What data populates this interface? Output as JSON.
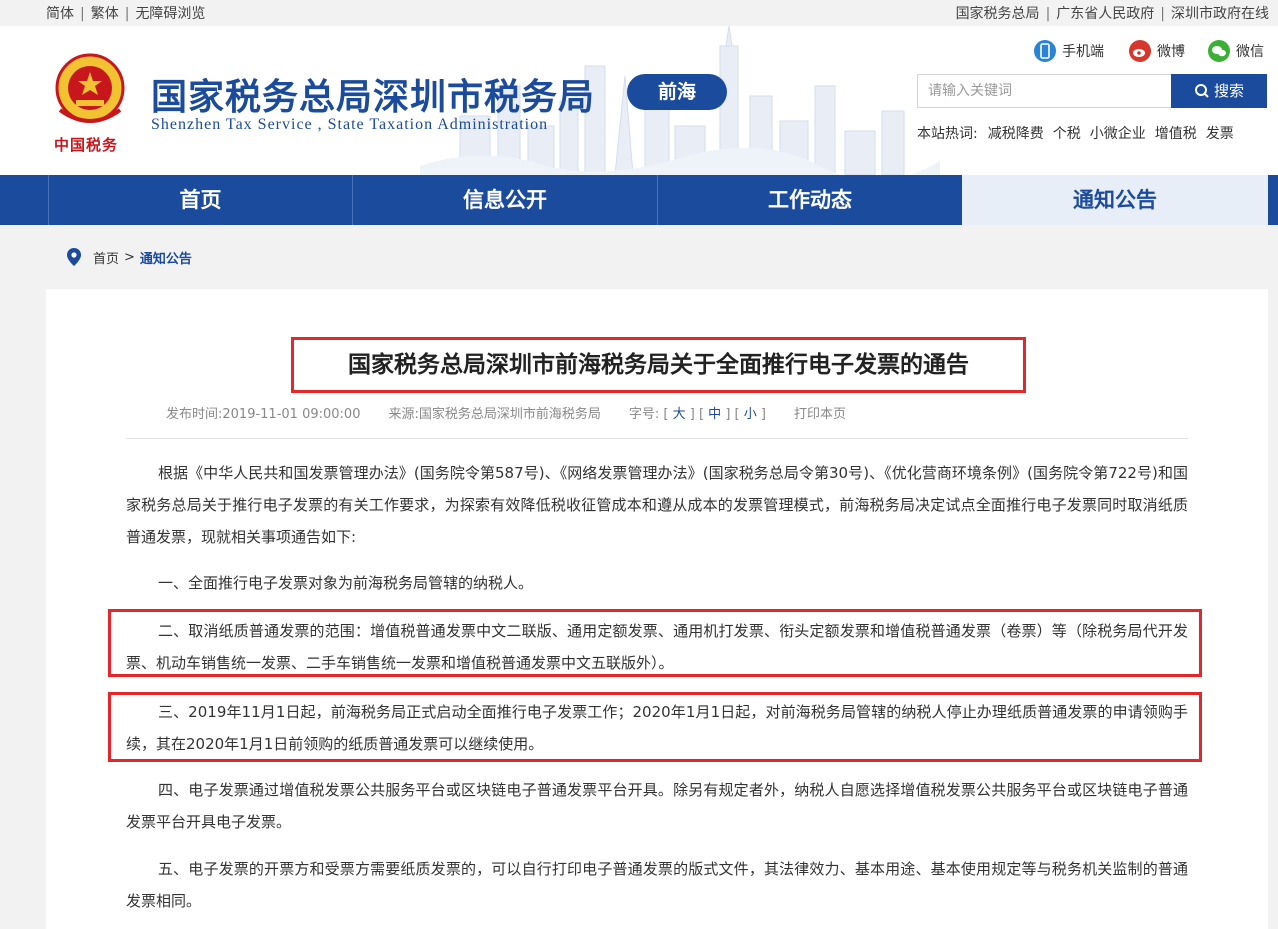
{
  "topbar": {
    "left_links": [
      "简体",
      "繁体",
      "无障碍浏览"
    ],
    "right_links": [
      "国家税务总局",
      "广东省人民政府",
      "深圳市政府在线"
    ]
  },
  "header": {
    "emblem_text": "中国税务",
    "title": "国家税务总局深圳市税务局",
    "subtitle": "Shenzhen  Tax  Service , State  Taxation  Administration",
    "region_badge": "前海",
    "social": {
      "mobile": "手机端",
      "weibo": "微博",
      "wechat": "微信"
    },
    "search": {
      "placeholder": "请输入关键词",
      "button": "搜索"
    },
    "hotwords_label": "本站热词:",
    "hotwords": [
      "减税降费",
      "个税",
      "小微企业",
      "增值税",
      "发票"
    ]
  },
  "nav": {
    "items": [
      "首页",
      "信息公开",
      "工作动态",
      "通知公告"
    ],
    "active": "通知公告"
  },
  "breadcrumb": {
    "home": "首页",
    "separator": ">",
    "current": "通知公告"
  },
  "article": {
    "title": "国家税务总局深圳市前海税务局关于全面推行电子发票的通告",
    "publish_label": "发布时间:",
    "publish_time": "2019-11-01 09:00:00",
    "source_label": "来源:",
    "source": "国家税务总局深圳市前海税务局",
    "fontsize_label": "字号:",
    "size_large": "大",
    "size_medium": "中",
    "size_small": "小",
    "print": "打印本页",
    "paragraphs": [
      "根据《中华人民共和国发票管理办法》(国务院令第587号)、《网络发票管理办法》(国家税务总局令第30号)、《优化营商环境条例》(国务院令第722号)和国家税务总局关于推行电子发票的有关工作要求，为探索有效降低税收征管成本和遵从成本的发票管理模式，前海税务局决定试点全面推行电子发票同时取消纸质普通发票，现就相关事项通告如下:",
      "一、全面推行电子发票对象为前海税务局管辖的纳税人。",
      "二、取消纸质普通发票的范围：增值税普通发票中文二联版、通用定额发票、通用机打发票、衔头定额发票和增值税普通发票（卷票）等（除税务局代开发票、机动车销售统一发票、二手车销售统一发票和增值税普通发票中文五联版外）。",
      "三、2019年11月1日起，前海税务局正式启动全面推行电子发票工作；2020年1月1日起，对前海税务局管辖的纳税人停止办理纸质普通发票的申请领购手续，其在2020年1月1日前领购的纸质普通发票可以继续使用。",
      "四、电子发票通过增值税发票公共服务平台或区块链电子普通发票平台开具。除另有规定者外，纳税人自愿选择增值税发票公共服务平台或区块链电子普通发票平台开具电子发票。",
      "五、电子发票的开票方和受票方需要纸质发票的，可以自行打印电子普通发票的版式文件，其法律效力、基本用途、基本使用规定等与税务机关监制的普通发票相同。"
    ]
  },
  "colors": {
    "brand_blue": "#1b4b9c",
    "highlight_red": "#e5272a",
    "emblem_red": "#c8161d"
  }
}
